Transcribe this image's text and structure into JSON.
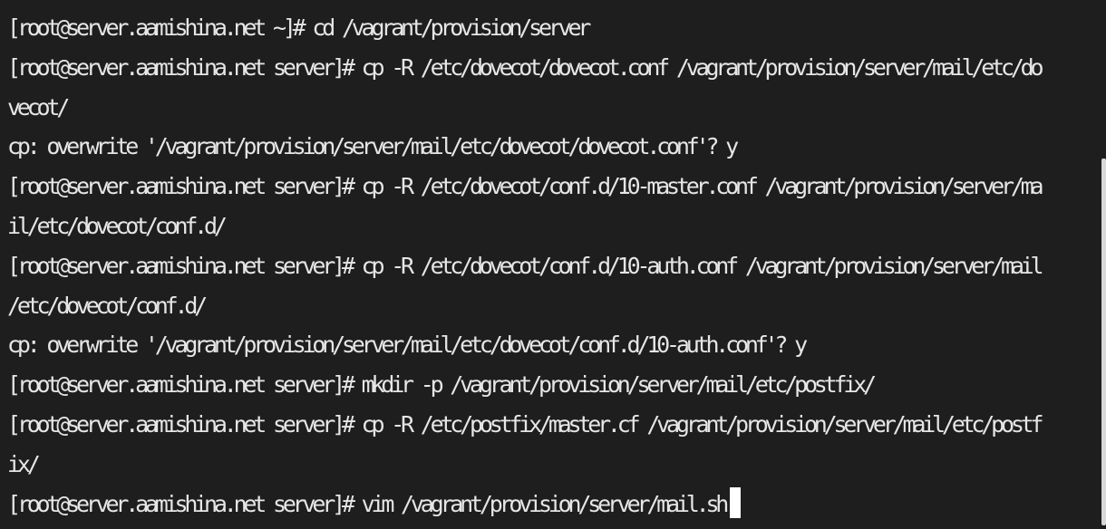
{
  "terminal": {
    "lines": [
      "[root@server.aamishina.net ~]# cd /vagrant/provision/server",
      "[root@server.aamishina.net server]# cp -R /etc/dovecot/dovecot.conf /vagrant/provision/server/mail/etc/do",
      "vecot/",
      "cp: overwrite '/vagrant/provision/server/mail/etc/dovecot/dovecot.conf'? y",
      "[root@server.aamishina.net server]# cp -R /etc/dovecot/conf.d/10-master.conf /vagrant/provision/server/ma",
      "il/etc/dovecot/conf.d/",
      "[root@server.aamishina.net server]# cp -R /etc/dovecot/conf.d/10-auth.conf /vagrant/provision/server/mail",
      "/etc/dovecot/conf.d/",
      "cp: overwrite '/vagrant/provision/server/mail/etc/dovecot/conf.d/10-auth.conf'? y",
      "[root@server.aamishina.net server]# mkdir -p /vagrant/provision/server/mail/etc/postfix/",
      "[root@server.aamishina.net server]# cp -R /etc/postfix/master.cf /vagrant/provision/server/mail/etc/postf",
      "ix/",
      "[root@server.aamishina.net server]# vim /vagrant/provision/server/mail.sh"
    ],
    "colors": {
      "background": "#1e1e1e",
      "foreground": "#e6e6e6",
      "cursor": "#ffffff",
      "scrollbar": "#d8d8d8"
    }
  }
}
